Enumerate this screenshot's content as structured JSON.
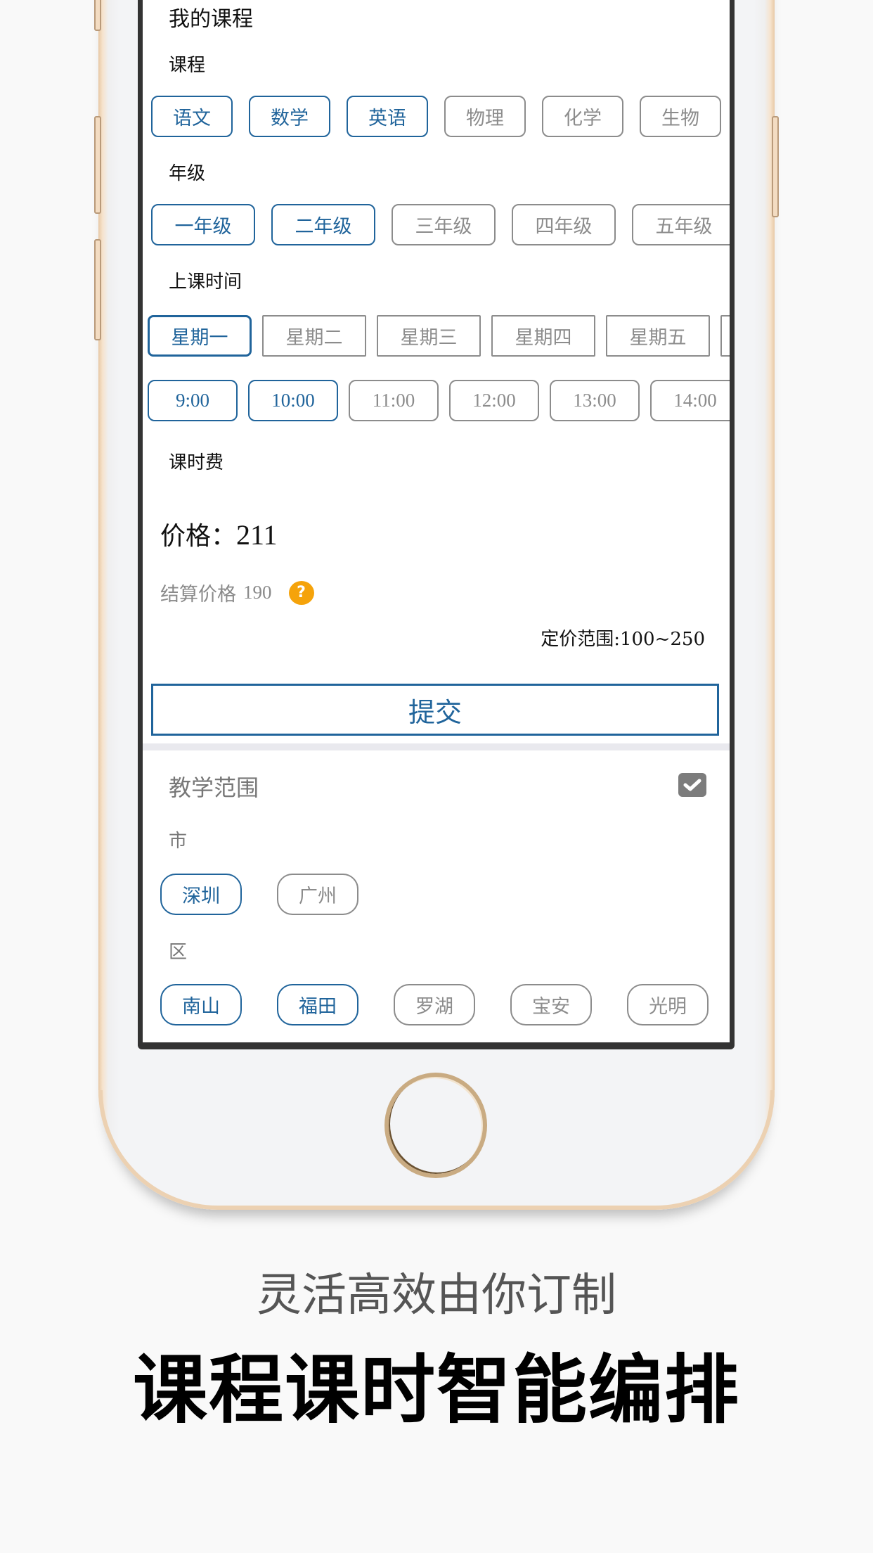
{
  "screen": {
    "title": "我的课程",
    "course_section": {
      "label": "课程",
      "options": [
        {
          "label": "语文",
          "selected": true
        },
        {
          "label": "数学",
          "selected": true
        },
        {
          "label": "英语",
          "selected": true
        },
        {
          "label": "物理",
          "selected": false
        },
        {
          "label": "化学",
          "selected": false
        },
        {
          "label": "生物",
          "selected": false
        }
      ]
    },
    "grade_section": {
      "label": "年级",
      "options": [
        {
          "label": "一年级",
          "selected": true
        },
        {
          "label": "二年级",
          "selected": true
        },
        {
          "label": "三年级",
          "selected": false
        },
        {
          "label": "四年级",
          "selected": false
        },
        {
          "label": "五年级",
          "selected": false
        }
      ]
    },
    "time_section": {
      "label": "上课时间",
      "weekdays": [
        {
          "label": "星期一",
          "selected": true
        },
        {
          "label": "星期二",
          "selected": false
        },
        {
          "label": "星期三",
          "selected": false
        },
        {
          "label": "星期四",
          "selected": false
        },
        {
          "label": "星期五",
          "selected": false
        },
        {
          "label": "",
          "selected": false
        }
      ],
      "hours": [
        {
          "label": "9:00",
          "selected": true
        },
        {
          "label": "10:00",
          "selected": true
        },
        {
          "label": "11:00",
          "selected": false
        },
        {
          "label": "12:00",
          "selected": false
        },
        {
          "label": "13:00",
          "selected": false
        },
        {
          "label": "14:00",
          "selected": false
        }
      ]
    },
    "fee_section": {
      "label": "课时费",
      "price_label": "价格：",
      "price_value": "211",
      "settlement_label": "结算价格",
      "settlement_value": "190",
      "help_icon": "question-circle-icon",
      "range_text": "定价范围:100~250"
    },
    "submit_label": "提交",
    "scope_section": {
      "title": "教学范围",
      "checked": true,
      "city_label": "市",
      "cities": [
        {
          "label": "深圳",
          "selected": true
        },
        {
          "label": "广州",
          "selected": false
        }
      ],
      "district_label": "区",
      "districts": [
        {
          "label": "南山",
          "selected": true
        },
        {
          "label": "福田",
          "selected": true
        },
        {
          "label": "罗湖",
          "selected": false
        },
        {
          "label": "宝安",
          "selected": false
        },
        {
          "label": "光明",
          "selected": false
        }
      ]
    }
  },
  "promo": {
    "subtitle": "灵活高效由你订制",
    "headline": "课程课时智能编排"
  },
  "colors": {
    "accent": "#20649b",
    "unselected": "#8c8c8c",
    "help": "#f5a30b",
    "phone_gold": "#e8c9a6"
  }
}
